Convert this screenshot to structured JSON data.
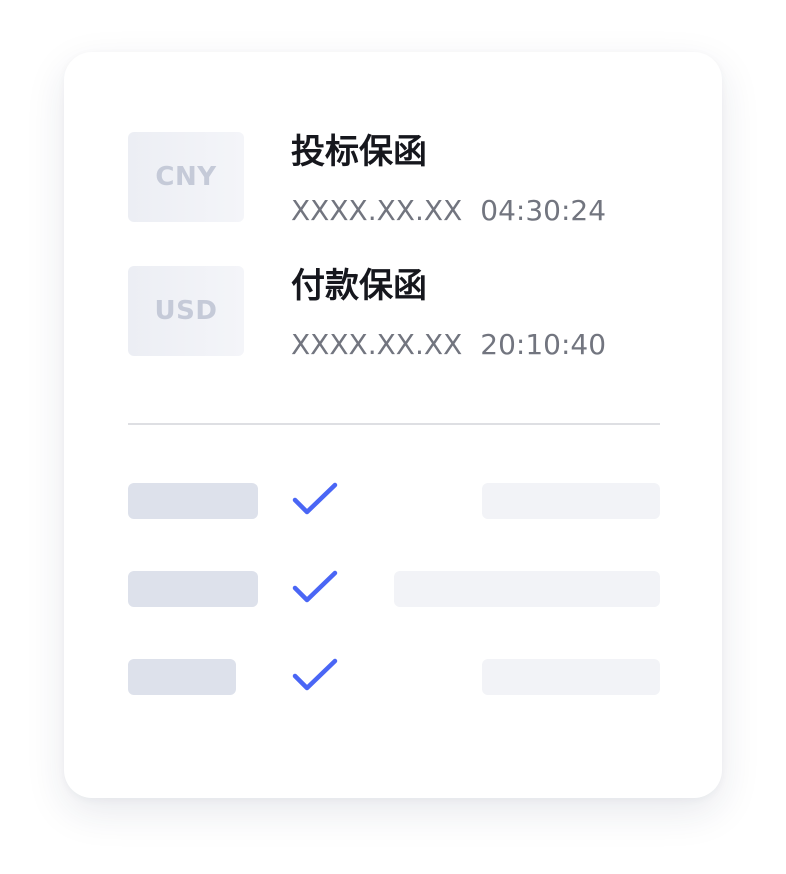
{
  "guarantees": [
    {
      "currency": "CNY",
      "title": "投标保函",
      "date": "XXXX.XX.XX",
      "time": "04:30:24"
    },
    {
      "currency": "USD",
      "title": "付款保函",
      "date": "XXXX.XX.XX",
      "time": "20:10:40"
    }
  ],
  "checklist": [
    {
      "icon": "checkmark-icon",
      "checked": true
    },
    {
      "icon": "checkmark-icon",
      "checked": true
    },
    {
      "icon": "checkmark-icon",
      "checked": true
    }
  ],
  "colors": {
    "accent": "#4a66f5",
    "title_text": "#16171d",
    "meta_text": "#72757f",
    "badge_text": "#c5cad8",
    "placeholder_dark": "#dde1eb",
    "placeholder_light": "#f2f3f7"
  }
}
